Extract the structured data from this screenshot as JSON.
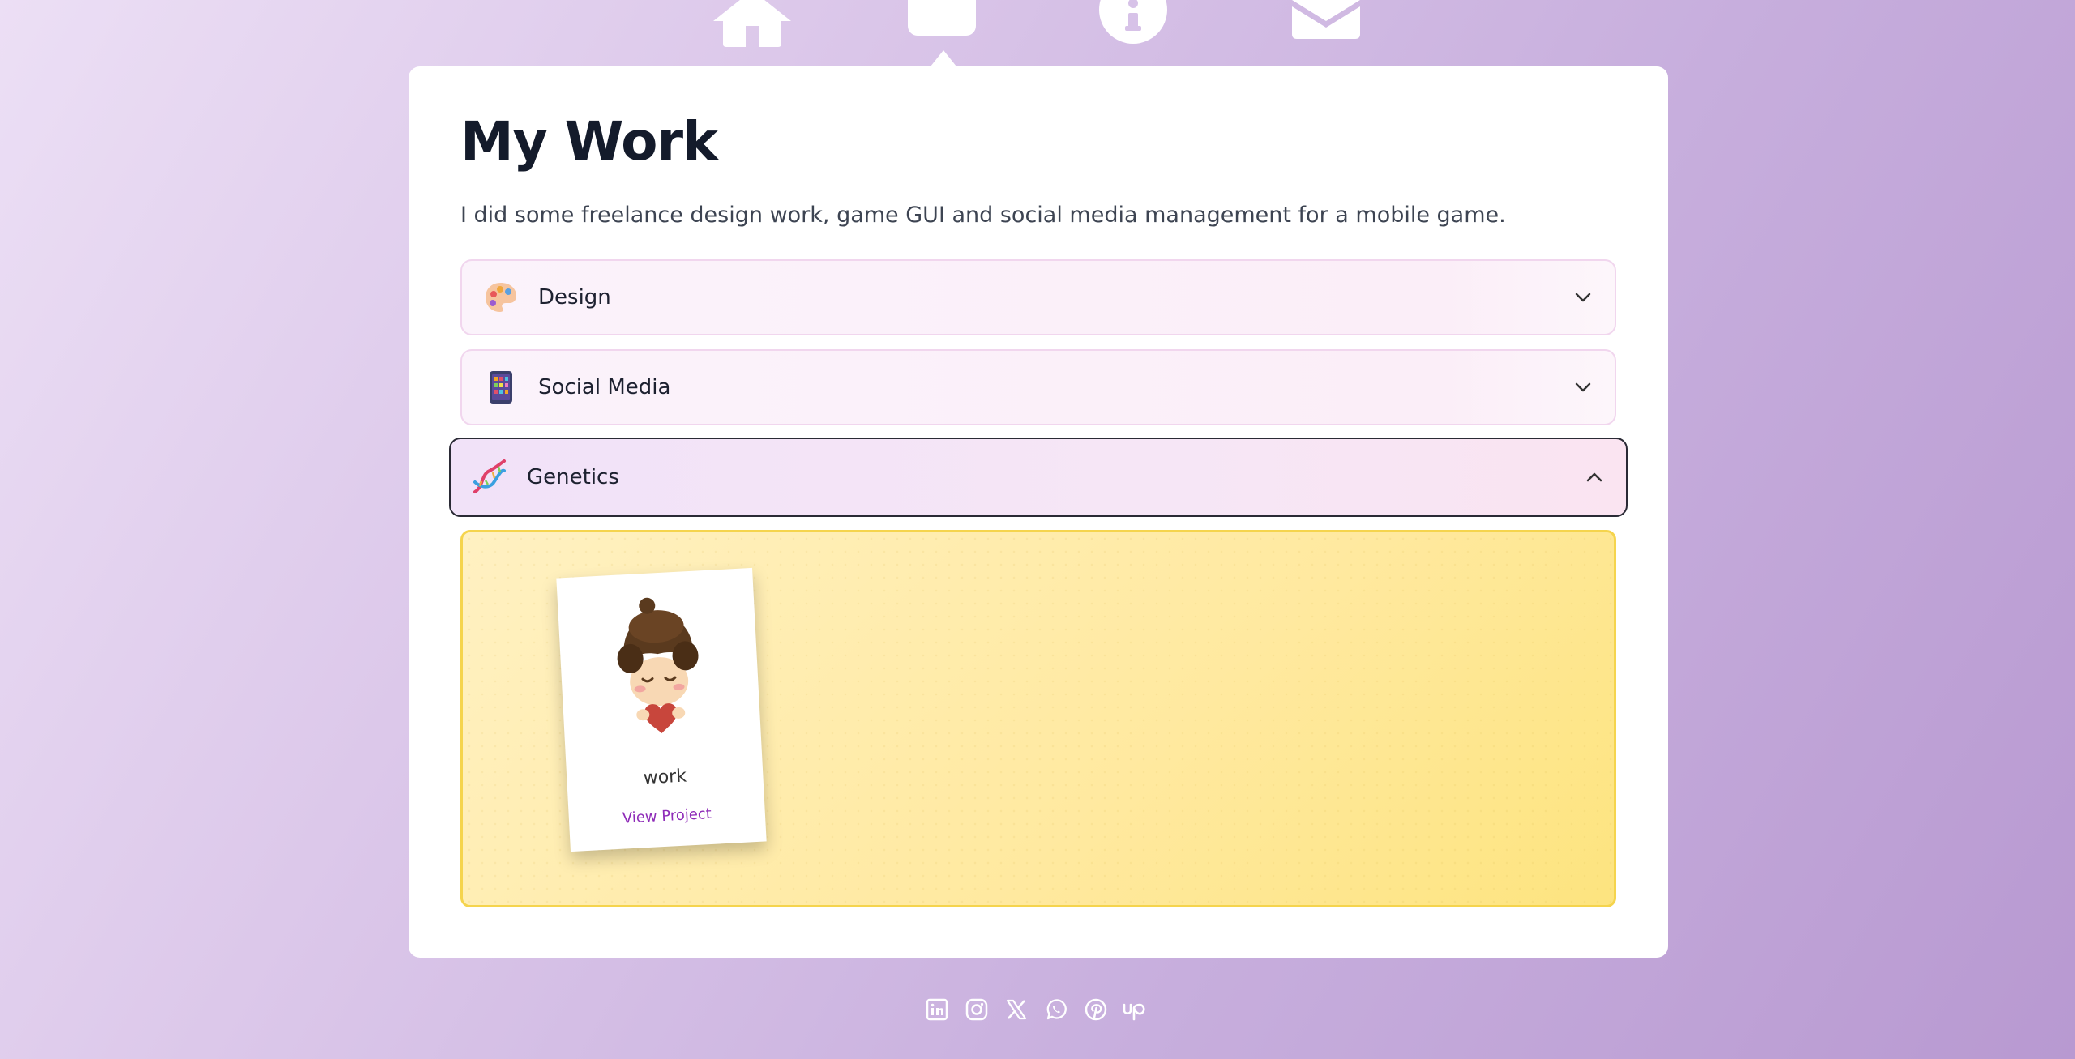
{
  "nav": {
    "items": [
      {
        "icon": "home-icon",
        "active": false
      },
      {
        "icon": "work-icon",
        "active": true
      },
      {
        "icon": "info-icon",
        "active": false
      },
      {
        "icon": "mail-icon",
        "active": false
      }
    ]
  },
  "page": {
    "title": "My Work",
    "lede": "I did some freelance design work, game GUI and social media management for a mobile game."
  },
  "accordion": [
    {
      "label": "Design",
      "icon": "palette-icon",
      "expanded": false
    },
    {
      "label": "Social Media",
      "icon": "phone-icon",
      "expanded": false
    },
    {
      "label": "Genetics",
      "icon": "dna-icon",
      "expanded": true
    }
  ],
  "panel": {
    "projects": [
      {
        "name": "work",
        "link_label": "View Project",
        "image": "chibi-character-holding-heart"
      }
    ]
  },
  "social": [
    {
      "icon": "linkedin-icon"
    },
    {
      "icon": "instagram-icon"
    },
    {
      "icon": "x-icon"
    },
    {
      "icon": "whatsapp-icon"
    },
    {
      "icon": "pinterest-icon"
    },
    {
      "icon": "upwork-icon"
    }
  ],
  "colors": {
    "title": "#141b2b",
    "link": "#8e2bb8",
    "panel_border": "#f5d44d",
    "open_border": "#2a2a35"
  }
}
